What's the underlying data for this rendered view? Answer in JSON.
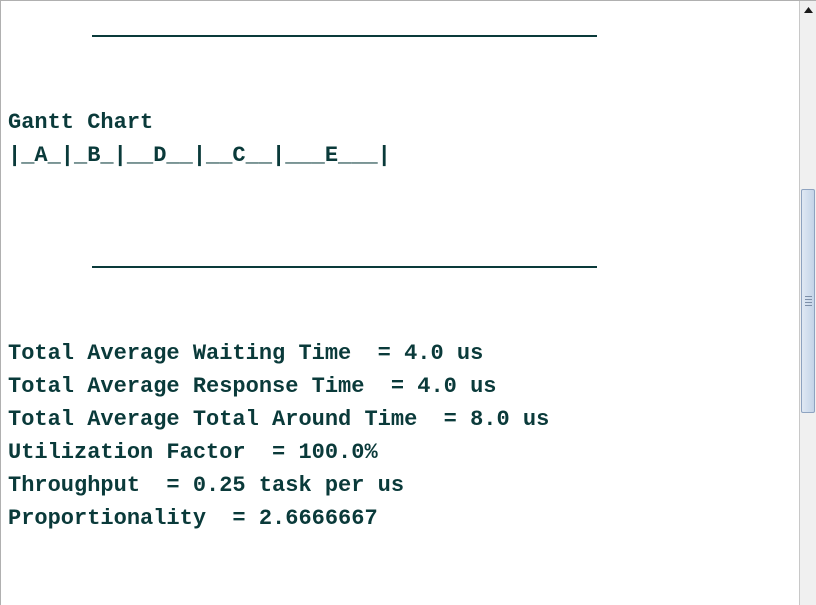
{
  "output": {
    "gantt_title": "Gantt Chart",
    "gantt_row": "|_A_|_B_|__D__|__C__|___E___|",
    "stats": [
      "Total Average Waiting Time  = 4.0 us",
      "Total Average Response Time  = 4.0 us",
      "Total Average Total Around Time  = 8.0 us",
      "Utilization Factor  = 100.0%",
      "Throughput  = 0.25 task per us",
      "Proportionality  = 2.6666667"
    ]
  },
  "scrollbar": {
    "up_icon": "arrow-up-icon",
    "grip_icon": "grip-icon"
  }
}
